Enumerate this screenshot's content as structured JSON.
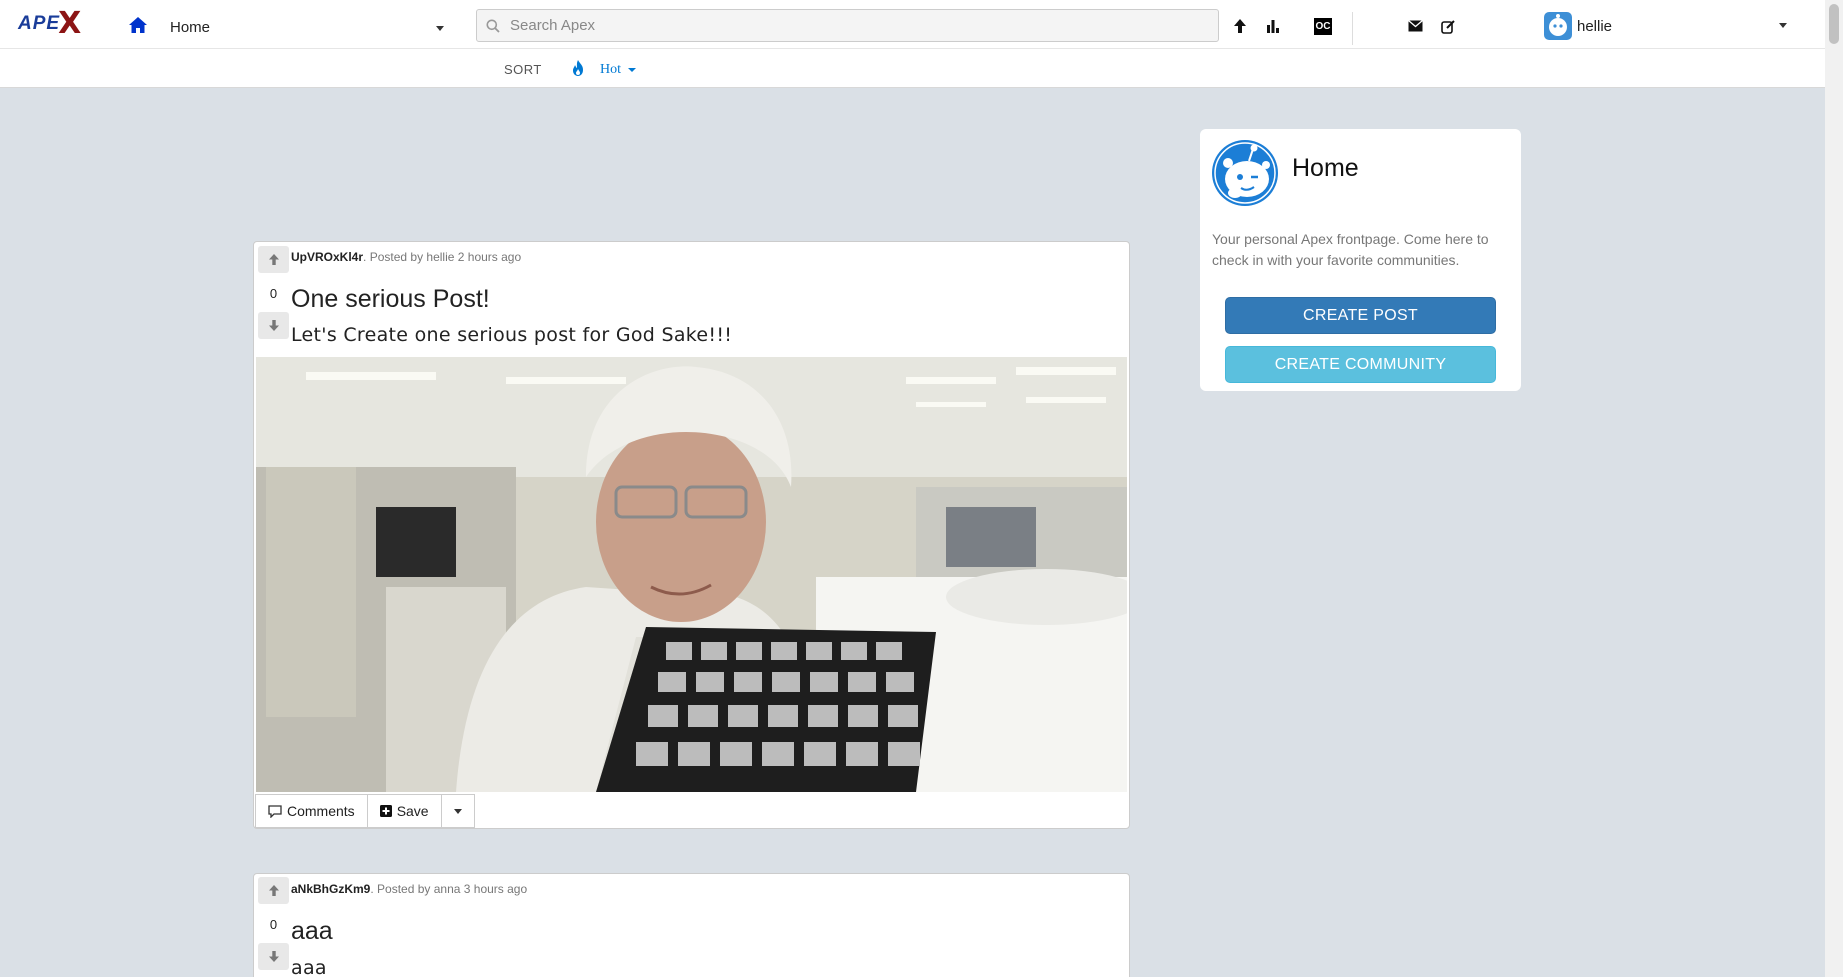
{
  "header": {
    "logo_text": "APE",
    "logo_x": "X",
    "feed_label": "Home",
    "search_placeholder": "Search Apex",
    "oc_badge": "OC",
    "username": "hellie"
  },
  "sort": {
    "label": "SORT",
    "value": "Hot"
  },
  "posts": [
    {
      "community": "UpVROxKl4r",
      "posted_by_text": ". Posted by ",
      "author": "hellie",
      "age": " 2 hours ago",
      "score": "0",
      "title": "One serious Post!",
      "body": "Let's Create one serious post for God Sake!!!"
    },
    {
      "community": "aNkBhGzKm9",
      "posted_by_text": ". Posted by ",
      "author": "anna",
      "age": " 3 hours ago",
      "score": "0",
      "title": "aaa",
      "body": "aaa"
    }
  ],
  "actions": {
    "comments": "Comments",
    "save": "Save"
  },
  "sidebar": {
    "title": "Home",
    "description": "Your personal Apex frontpage. Come here to check in with your favorite communities.",
    "create_post": "CREATE POST",
    "create_community": "CREATE COMMUNITY"
  },
  "colors": {
    "page_bg": "#dae0e6",
    "accent": "#0079d3",
    "primary_button": "#337ab7",
    "info_button": "#5bc0de",
    "logo_blue": "#1a3c99",
    "logo_red": "#8c1414"
  }
}
